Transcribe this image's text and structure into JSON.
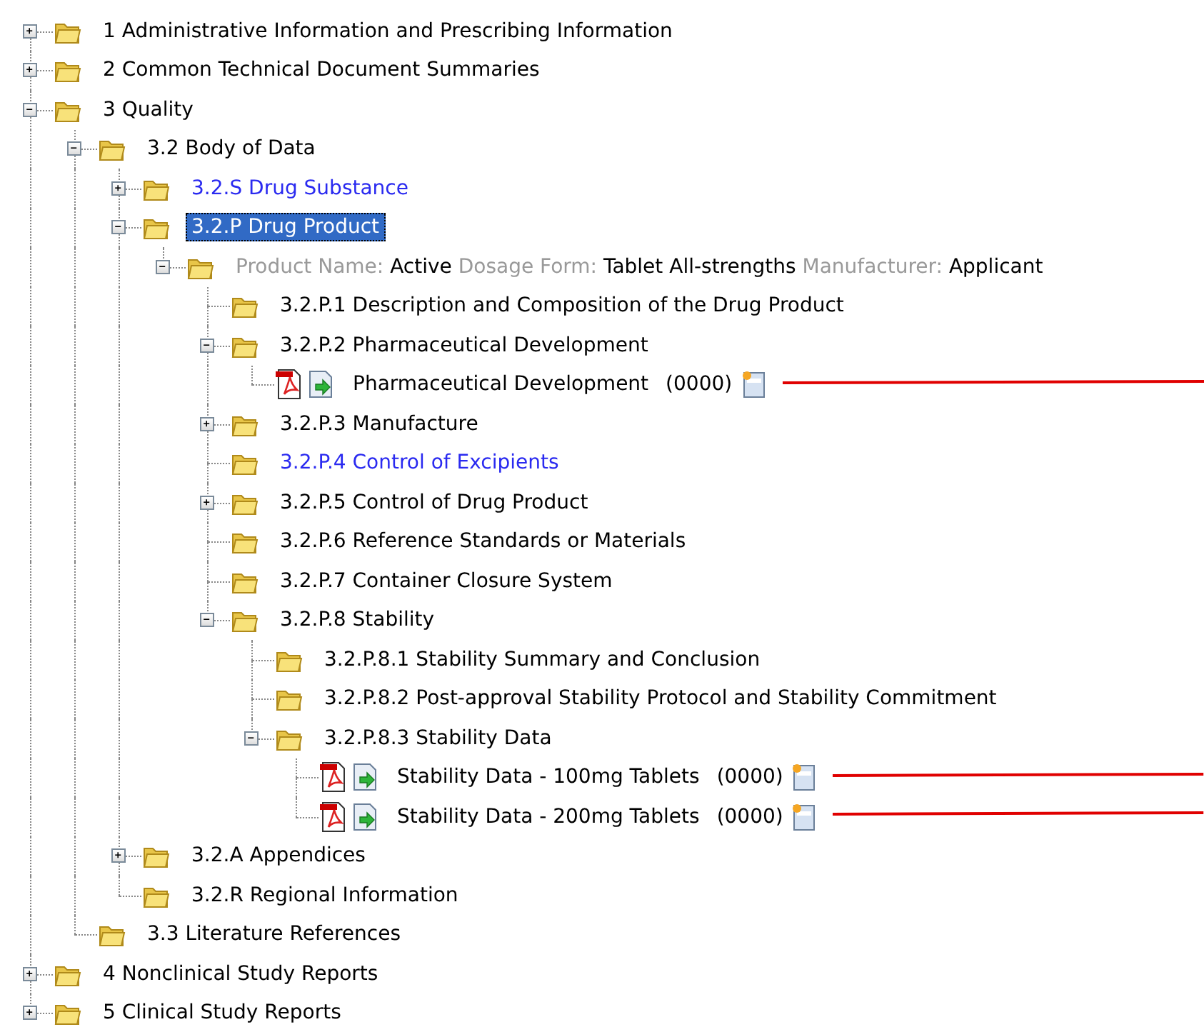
{
  "tree": [
    {
      "kind": "folder",
      "label": "1 Administrative Information and Prescribing Information",
      "expanded": false,
      "selected": false
    },
    {
      "kind": "folder",
      "label": "2 Common Technical Document Summaries",
      "expanded": false,
      "selected": false
    },
    {
      "kind": "folder",
      "label": "3 Quality",
      "expanded": true,
      "selected": false,
      "children": [
        {
          "kind": "folder",
          "label": "3.2 Body of Data",
          "expanded": true,
          "selected": false,
          "children": [
            {
              "kind": "folder",
              "label": "3.2.S Drug Substance",
              "link": true,
              "expanded": false,
              "selected": false
            },
            {
              "kind": "folder",
              "label": "3.2.P Drug Product",
              "expanded": true,
              "selected": true,
              "children": [
                {
                  "kind": "product",
                  "expanded": true,
                  "selected": false,
                  "parts": [
                    {
                      "label": "Product Name:",
                      "value": "Active"
                    },
                    {
                      "label": "Dosage Form:",
                      "value": "Tablet  All-strengths"
                    },
                    {
                      "label": "Manufacturer:",
                      "value": "Applicant"
                    }
                  ],
                  "children": [
                    {
                      "kind": "folder",
                      "label": "3.2.P.1 Description and Composition of the Drug Product",
                      "selected": false
                    },
                    {
                      "kind": "folder",
                      "label": "3.2.P.2 Pharmaceutical Development",
                      "expanded": true,
                      "selected": false,
                      "children": [
                        {
                          "kind": "document",
                          "label": "Pharmaceutical Development",
                          "code": "(0000)",
                          "leader": true,
                          "selected": false
                        }
                      ]
                    },
                    {
                      "kind": "folder",
                      "label": "3.2.P.3 Manufacture",
                      "expanded": false,
                      "selected": false
                    },
                    {
                      "kind": "folder",
                      "label": "3.2.P.4 Control of Excipients",
                      "link": true,
                      "selected": false
                    },
                    {
                      "kind": "folder",
                      "label": "3.2.P.5 Control of Drug Product",
                      "expanded": false,
                      "selected": false
                    },
                    {
                      "kind": "folder",
                      "label": "3.2.P.6 Reference Standards or Materials",
                      "selected": false
                    },
                    {
                      "kind": "folder",
                      "label": "3.2.P.7 Container Closure System",
                      "selected": false
                    },
                    {
                      "kind": "folder",
                      "label": "3.2.P.8 Stability",
                      "expanded": true,
                      "selected": false,
                      "children": [
                        {
                          "kind": "folder",
                          "label": "3.2.P.8.1 Stability Summary and Conclusion",
                          "selected": false
                        },
                        {
                          "kind": "folder",
                          "label": "3.2.P.8.2 Post-approval Stability Protocol and Stability Commitment",
                          "selected": false
                        },
                        {
                          "kind": "folder",
                          "label": "3.2.P.8.3 Stability Data",
                          "expanded": true,
                          "selected": false,
                          "children": [
                            {
                              "kind": "document",
                              "label": "Stability Data - 100mg Tablets",
                              "code": "(0000)",
                              "leader": true,
                              "selected": false
                            },
                            {
                              "kind": "document",
                              "label": "Stability Data - 200mg Tablets",
                              "code": "(0000)",
                              "leader": true,
                              "selected": false
                            }
                          ]
                        }
                      ]
                    }
                  ]
                }
              ]
            },
            {
              "kind": "folder",
              "label": "3.2.A Appendices",
              "expanded": false,
              "selected": false
            },
            {
              "kind": "folder",
              "label": "3.2.R Regional Information",
              "selected": false
            }
          ]
        },
        {
          "kind": "folder",
          "label": "3.3 Literature References",
          "selected": false
        }
      ]
    },
    {
      "kind": "folder",
      "label": "4 Nonclinical Study Reports",
      "expanded": false,
      "selected": false
    },
    {
      "kind": "folder",
      "label": "5 Clinical Study Reports",
      "expanded": false,
      "selected": false
    }
  ]
}
